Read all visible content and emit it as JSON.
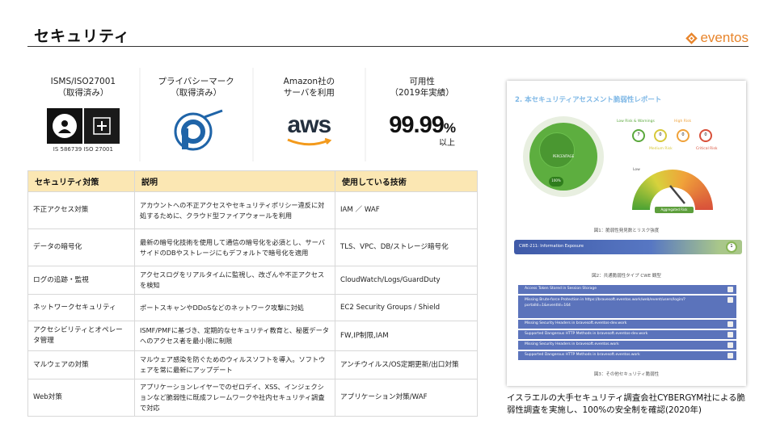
{
  "page": {
    "title": "セキュリティ"
  },
  "brand": {
    "name": "eventos",
    "color": "#e8852c"
  },
  "cards": [
    {
      "title": "ISMS/ISO27001\n（取得済み）",
      "logo_text": "IS 586739  ISO 27001"
    },
    {
      "title": "プライバシーマーク\n（取得済み）"
    },
    {
      "title": "Amazon社の\nサーバを利用",
      "logo_text": "aws"
    },
    {
      "title": "可用性\n（2019年実績）",
      "value": "99.99",
      "unit": "%",
      "note": "以上"
    }
  ],
  "table": {
    "headers": [
      "セキュリティ対策",
      "説明",
      "使用している技術"
    ],
    "header_color": "#fbe7b3",
    "rows": [
      {
        "measure": "不正アクセス対策",
        "desc": "アカウントへの不正アクセスやセキュリティポリシー違反に対処するために、クラウド型ファイアウォールを利用",
        "tech": "IAM ／ WAF"
      },
      {
        "measure": "データの暗号化",
        "desc": "最新の暗号化技術を使用して通信の暗号化を必須とし、サーバサイドのDBやストレージにもデフォルトで暗号化を適用",
        "tech": "TLS、VPC、DB/ストレージ暗号化"
      },
      {
        "measure": "ログの追跡・監視",
        "desc": "アクセスログをリアルタイムに監視し、改ざんや不正アクセスを検知",
        "tech": "CloudWatch/Logs/GuardDuty"
      },
      {
        "measure": "ネットワークセキュリティ",
        "desc": "ポートスキャンやDDoSなどのネットワーク攻撃に対処",
        "tech": "EC2 Security Groups / Shield"
      },
      {
        "measure": "アクセシビリティとオペレータ管理",
        "desc": "ISMF/PMFに基づき、定期的なセキュリティ教育と、秘匿データへのアクセス者を最小限に制限",
        "tech": "FW,IP制限,IAM"
      },
      {
        "measure": "マルウェアの対策",
        "desc": "マルウェア感染を防ぐためのウィルスソフトを導入。ソフトウェアを常に最新にアップデート",
        "tech": "アンチウイルス/OS定期更新/出口対策"
      },
      {
        "measure": "Web対策",
        "desc": "アプリケーションレイヤーでのゼロデイ、XSS、インジェクションなど脆弱性に既成フレームワークや社内セキュリティ調査で対応",
        "tech": "アプリケーション対策/WAF"
      }
    ]
  },
  "report": {
    "title": "2. 本セキュリティアセスメント脆弱性レポート",
    "risk_labels": [
      "Low Risk & Warnings",
      "Medium Risk",
      "High Risk",
      "Critical Risk"
    ],
    "risk_colors": [
      "#5aa83c",
      "#d7c83a",
      "#f0a23a",
      "#d8503a"
    ],
    "risk_counts": [
      "7",
      "0",
      "0",
      "0"
    ],
    "donut_label": "PERCENTAGE",
    "donut_value": "100%",
    "gauge_low": "Low",
    "gauge_tag": "Aggregated Risk",
    "fig1": "図1：脆弱性発見数とリスク強度",
    "cwe_label": "CWE-211: Information Exposure",
    "cwe_count": "1",
    "fig2": "図2：共通脆弱性タイプ CWE 観型",
    "items": [
      {
        "text": "Access Token Stored in Session Storage",
        "tall": false
      },
      {
        "text": "Missing Brute-force Protection in https://bravesoft.eventos.work/web/event/users/login/?portalId=1&eventId=164",
        "tall": true
      },
      {
        "text": "Missing Security Headers in bravesoft.eventos-dev.work",
        "tall": false
      },
      {
        "text": "Supported Dangerous HTTP Methods in bravesoft.eventos-dev.work",
        "tall": false
      },
      {
        "text": "Missing Security Headers in bravesoft.eventos.work",
        "tall": false
      },
      {
        "text": "Supported Dangerous HTTP Methods in bravesoft.eventos.work",
        "tall": false
      }
    ],
    "fig3": "図3：その他セキュリティ脆弱性"
  },
  "caption": "イスラエルの大手セキュリティ調査会社CYBERGYM社による脆弱性調査を実施し、100%の安全制を確認(2020年)"
}
